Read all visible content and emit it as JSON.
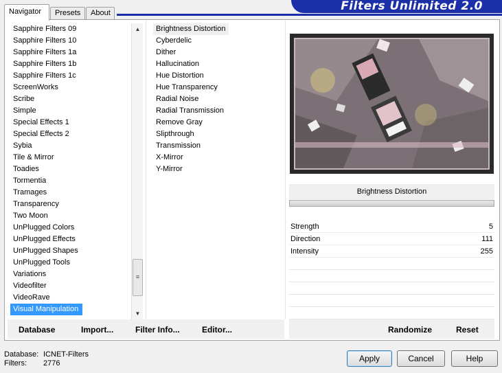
{
  "tabs": [
    {
      "label": "Navigator",
      "active": true
    },
    {
      "label": "Presets",
      "active": false
    },
    {
      "label": "About",
      "active": false
    }
  ],
  "banner": {
    "title": "Filters Unlimited 2.0",
    "color": "#1a2fa8"
  },
  "categories": [
    "Sapphire Filters 09",
    "Sapphire Filters 10",
    "Sapphire Filters 1a",
    "Sapphire Filters 1b",
    "Sapphire Filters 1c",
    "ScreenWorks",
    "Scribe",
    "Simple",
    "Special Effects 1",
    "Special Effects 2",
    "Sybia",
    "Tile & Mirror",
    "Toadies",
    "Tormentia",
    "Tramages",
    "Transparency",
    "Two Moon",
    "UnPlugged Colors",
    "UnPlugged Effects",
    "UnPlugged Shapes",
    "UnPlugged Tools",
    "Variations",
    "Videofilter",
    "VideoRave",
    "Visual Manipulation"
  ],
  "selected_category": "Visual Manipulation",
  "filters": [
    "Brightness Distortion",
    "Cyberdelic",
    "Dither",
    "Hallucination",
    "Hue Distortion",
    "Hue Transparency",
    "Radial Noise",
    "Radial Transmission",
    "Remove Gray",
    "Slipthrough",
    "Transmission",
    "X-Mirror",
    "Y-Mirror"
  ],
  "selected_filter": "Brightness Distortion",
  "filter_title": "Brightness Distortion",
  "params": [
    {
      "name": "Strength",
      "value": "5"
    },
    {
      "name": "Direction",
      "value": "111"
    },
    {
      "name": "Intensity",
      "value": "255"
    }
  ],
  "toolbar": {
    "database": "Database",
    "import": "Import...",
    "filter_info": "Filter Info...",
    "editor": "Editor...",
    "randomize": "Randomize",
    "reset": "Reset"
  },
  "footer": {
    "database_label": "Database:",
    "database_value": "ICNET-Filters",
    "filters_label": "Filters:",
    "filters_value": "2776"
  },
  "buttons": {
    "apply": "Apply",
    "cancel": "Cancel",
    "help": "Help"
  },
  "colors": {
    "selection": "#3399ff",
    "accent": "#1a2fa8"
  }
}
